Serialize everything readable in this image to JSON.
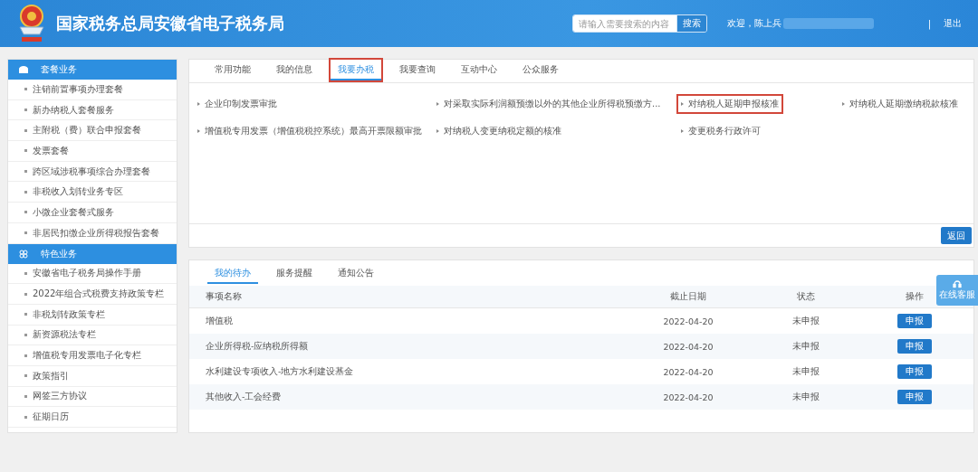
{
  "header": {
    "title": "国家税务总局安徽省电子税务局",
    "search": {
      "placeholder": "请输入需要搜索的内容",
      "button": "搜索"
    },
    "welcome": "欢迎，陈上兵",
    "separator": "|",
    "logout": "退出"
  },
  "sidebar": {
    "sections": [
      {
        "title": "套餐业务",
        "kind": "package",
        "items": [
          "注销前置事项办理套餐",
          "新办纳税人套餐服务",
          "主附税（费）联合申报套餐",
          "发票套餐",
          "跨区域涉税事项综合办理套餐",
          "非税收入划转业务专区",
          "小微企业套餐式服务",
          "非居民扣缴企业所得税报告套餐"
        ]
      },
      {
        "title": "特色业务",
        "kind": "feature",
        "items": [
          "安徽省电子税务局操作手册",
          "2022年组合式税费支持政策专栏",
          "非税划转政策专栏",
          "新资源税法专栏",
          "增值税专用发票电子化专栏",
          "政策指引",
          "网签三方协议",
          "征期日历"
        ]
      }
    ]
  },
  "menu": {
    "tabs": [
      {
        "label": "常用功能",
        "selected": false,
        "highlighted": false
      },
      {
        "label": "我的信息",
        "selected": false,
        "highlighted": false
      },
      {
        "label": "我要办税",
        "selected": true,
        "highlighted": true
      },
      {
        "label": "我要查询",
        "selected": false,
        "highlighted": false
      },
      {
        "label": "互动中心",
        "selected": false,
        "highlighted": false
      },
      {
        "label": "公众服务",
        "selected": false,
        "highlighted": false
      }
    ],
    "items": [
      {
        "label": "企业印制发票审批",
        "highlighted": false
      },
      {
        "label": "对采取实际利润额预缴以外的其他企业所得税预缴方...",
        "highlighted": false
      },
      {
        "label": "对纳税人延期申报核准",
        "highlighted": true
      },
      {
        "label": "对纳税人延期缴纳税款核准",
        "highlighted": false
      },
      {
        "label": "增值税专用发票（增值税税控系统）最高开票限额审批",
        "highlighted": false
      },
      {
        "label": "对纳税人变更纳税定额的核准",
        "highlighted": false
      },
      {
        "label": "变更税务行政许可",
        "highlighted": false
      }
    ],
    "back_button": "返回"
  },
  "todo": {
    "tabs": [
      {
        "label": "我的待办",
        "selected": true
      },
      {
        "label": "服务提醒",
        "selected": false
      },
      {
        "label": "通知公告",
        "selected": false
      }
    ],
    "columns": [
      "事项名称",
      "截止日期",
      "状态",
      "操作"
    ],
    "rows": [
      {
        "name": "增值税",
        "deadline": "2022-04-20",
        "status": "未申报",
        "action": "申报"
      },
      {
        "name": "企业所得税-应纳税所得额",
        "deadline": "2022-04-20",
        "status": "未申报",
        "action": "申报"
      },
      {
        "name": "水利建设专项收入-地方水利建设基金",
        "deadline": "2022-04-20",
        "status": "未申报",
        "action": "申报"
      },
      {
        "name": "其他收入-工会经费",
        "deadline": "2022-04-20",
        "status": "未申报",
        "action": "申报"
      }
    ]
  },
  "support_widget": {
    "label": "在线客服"
  }
}
